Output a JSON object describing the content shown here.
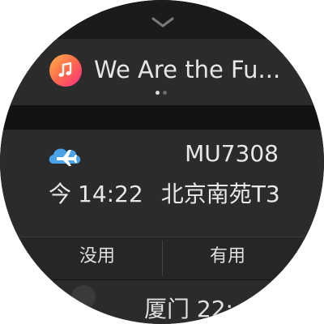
{
  "music": {
    "title": "We Are the Fu...",
    "icon": "music-note-icon",
    "icon_gradient": [
      "#ffb24a",
      "#ff6a4a",
      "#ff2d8a"
    ],
    "pager": {
      "current": 1,
      "total": 2
    }
  },
  "flight": {
    "icon": "airplane-cloud-icon",
    "icon_color": "#4aa3e8",
    "number": "MU7308",
    "day": "今",
    "time": "14:22",
    "location": "北京南苑T3"
  },
  "actions": {
    "not_useful": "没用",
    "useful": "有用"
  },
  "next_card": {
    "text": "厦门 22:"
  },
  "colors": {
    "background": "#121212",
    "card": "#2b2b2b",
    "text": "#e6e6e6"
  }
}
